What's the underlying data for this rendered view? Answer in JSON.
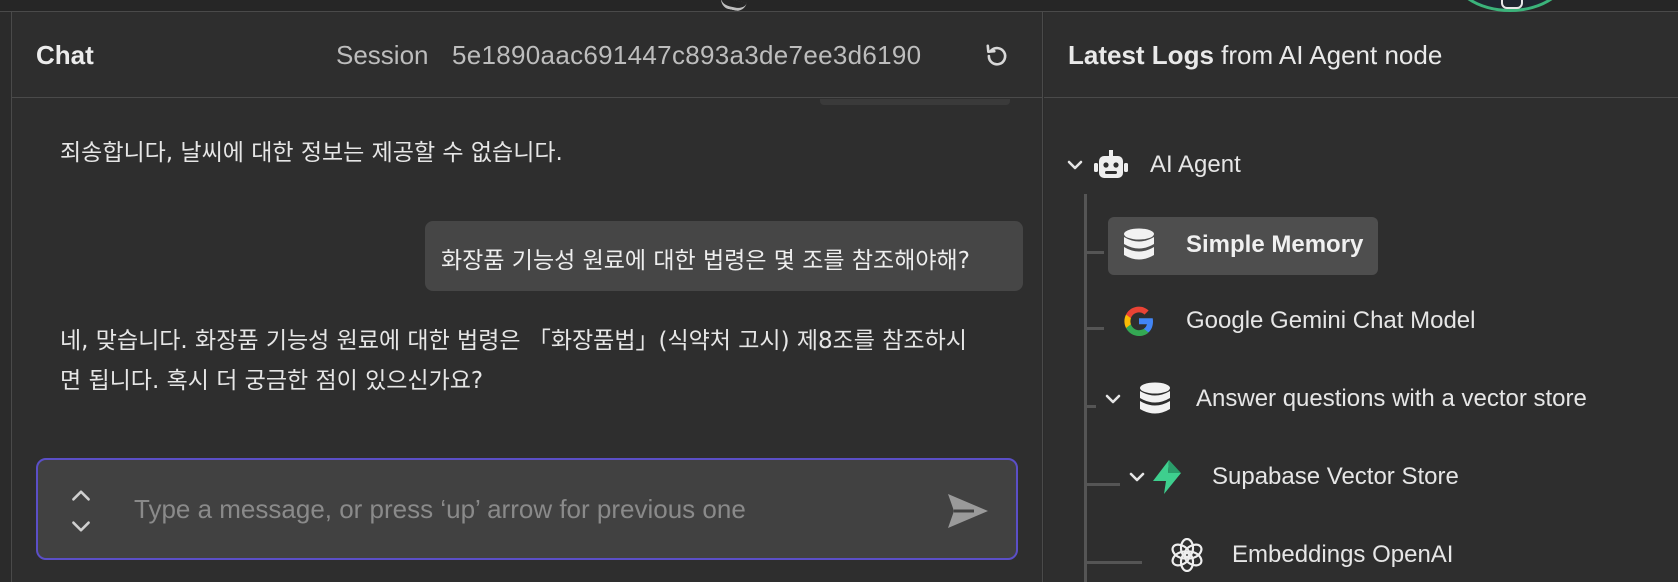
{
  "chat": {
    "title": "Chat",
    "session_label": "Session",
    "session_id": "5e1890aac691447c893a3de7ee3d6190",
    "messages": [
      {
        "role": "bot",
        "text": "죄송합니다, 날씨에 대한 정보는 제공할 수 없습니다."
      },
      {
        "role": "user",
        "text": "화장품 기능성 원료에 대한 법령은 몇 조를 참조해야해?"
      },
      {
        "role": "bot",
        "line1": "네, 맞습니다. 화장품 기능성 원료에 대한 법령은 「화장품법」(식약처 고시) 제8조를 참조하시",
        "line2": "면 됩니다. 혹시 더 궁금한 점이 있으신가요?"
      }
    ],
    "input": {
      "placeholder": "Type a message, or press ‘up’ arrow for previous one",
      "value": ""
    },
    "accent_color": "#5b4fc7"
  },
  "logs": {
    "title_bold": "Latest Logs",
    "title_rest": " from AI Agent node",
    "tree": [
      {
        "label": "AI Agent",
        "icon": "robot-icon",
        "expanded": true
      },
      {
        "label": "Simple Memory",
        "icon": "database-icon",
        "selected": true
      },
      {
        "label": "Google Gemini Chat Model",
        "icon": "google-icon"
      },
      {
        "label": "Answer questions with a vector store",
        "icon": "database-icon",
        "expanded": true
      },
      {
        "label": "Supabase Vector Store",
        "icon": "supabase-icon",
        "expanded": true
      },
      {
        "label": "Embeddings OpenAI",
        "icon": "openai-icon"
      }
    ]
  }
}
